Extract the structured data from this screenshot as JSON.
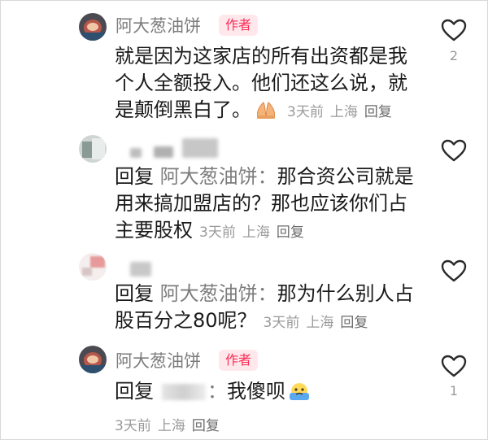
{
  "comments": [
    {
      "name": "阿大葱油饼",
      "badge": "作者",
      "text_lines": [
        "就是因为这家店的所有出资都是我",
        "个人全额投入。他们还这么说，就",
        "是颠倒黑白了。"
      ],
      "time": "3天前",
      "location": "上海",
      "reply_label": "回复",
      "likes": "2",
      "emoji": "folded-hands-emoji"
    },
    {
      "reply_word": "回复",
      "reply_target": "阿大葱油饼：",
      "text_lines_first": "那合资公司就是",
      "text_lines": [
        "用来搞加盟店的？那也应该你们占",
        "主要股权"
      ],
      "time": "3天前",
      "location": "上海",
      "reply_label": "回复"
    },
    {
      "reply_word": "回复",
      "reply_target": "阿大葱油饼：",
      "text_lines_first": "那为什么别人占",
      "text_lines": [
        "股百分之80呢？"
      ],
      "time": "3天前",
      "location": "上海",
      "reply_label": "回复"
    },
    {
      "name": "阿大葱油饼",
      "badge": "作者",
      "reply_word": "回复",
      "reply_target_partial": "：",
      "text": "我傻呗",
      "time": "3天前",
      "location": "上海",
      "reply_label": "回复",
      "likes": "1",
      "emoji": "crying-face-emoji"
    }
  ],
  "colors": {
    "accent": "#fe2c55",
    "badge_bg": "#ffe8eb",
    "meta": "#9a9a9a",
    "name": "#7d7d7d"
  },
  "icons": [
    "heart-outline-icon"
  ]
}
